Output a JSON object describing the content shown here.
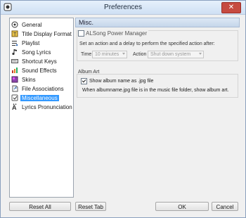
{
  "window": {
    "title": "Preferences"
  },
  "sidebar": {
    "items": [
      {
        "label": "General",
        "icon": "general-icon"
      },
      {
        "label": "Title Display Format",
        "icon": "title-format-icon"
      },
      {
        "label": "Playlist",
        "icon": "playlist-icon"
      },
      {
        "label": "Song Lyrics",
        "icon": "lyrics-icon"
      },
      {
        "label": "Shortcut Keys",
        "icon": "keyboard-icon"
      },
      {
        "label": "Sound Effects",
        "icon": "sound-effects-icon"
      },
      {
        "label": "Skins",
        "icon": "skins-icon"
      },
      {
        "label": "File Associations",
        "icon": "file-associations-icon"
      },
      {
        "label": "Miscellaneous",
        "icon": "miscellaneous-icon",
        "selected": true
      },
      {
        "label": "Lyrics Pronunciation",
        "icon": "pronunciation-icon"
      }
    ]
  },
  "content": {
    "header": "Misc.",
    "power_manager": {
      "checkbox_label": "ALSong Power Manager",
      "checked": false,
      "description": "Set an action and a delay to perform the specified action after:",
      "time_label": "Time",
      "time_value": "10 minutes",
      "action_label": "Action",
      "action_value": "Shut down system"
    },
    "album_art": {
      "group_label": "Album Art",
      "checkbox_label": "Show album name as .jpg file",
      "checked": true,
      "note": "When albumname.jpg file is in the music file folder, show album art."
    }
  },
  "buttons": {
    "reset_all": "Reset All",
    "reset_tab": "Reset Tab",
    "ok": "OK",
    "cancel": "Cancel"
  },
  "colors": {
    "selection": "#3399ff",
    "close": "#c64a40"
  }
}
